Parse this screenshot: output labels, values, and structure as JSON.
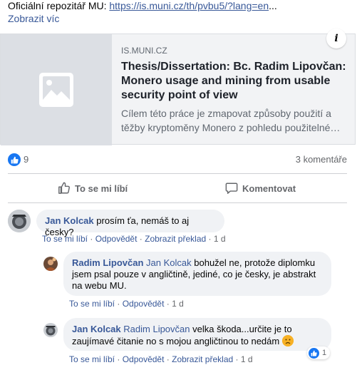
{
  "post": {
    "text_prefix": "Oficiální repozitář MU: ",
    "link_text": "https://is.muni.cz/th/pvbu5/?lang=en",
    "ellipsis": "...",
    "see_more": "Zobrazit víc"
  },
  "preview": {
    "domain": "IS.MUNI.CZ",
    "title": "Thesis/Dissertation: Bc. Radim Lipovčan: Monero usage and mining from usable security point of view",
    "description": "Cílem této práce je zmapovat způsoby použití a těžby kryptoměny Monero z pohledu použitelné…",
    "info_glyph": "i"
  },
  "stats": {
    "likes": "9",
    "comments": "3 komentáře"
  },
  "actions": {
    "like": "To se mi líbí",
    "comment": "Komentovat"
  },
  "comments": [
    {
      "author": "Jan Kolcak",
      "mention": "",
      "text": "prosím ťa, nemáš to aj česky?",
      "like": "To se mi líbí",
      "reply": "Odpovědět",
      "translate": "Zobrazit překlad",
      "time": "1 d"
    },
    {
      "author": "Radim Lipovčan",
      "mention": "Jan Kolcak",
      "text": "bohužel ne, protože diplomku jsem psal pouze v angličtině, jediné, co je česky, je abstrakt na webu MU.",
      "like": "To se mi líbí",
      "reply": "Odpovědět",
      "time": "1 d"
    },
    {
      "author": "Jan Kolcak",
      "mention": "Radim Lipovčan",
      "text": "velka škoda...určite je to zaujímavé čitanie no s mojou angličtinou to nedám",
      "like": "To se mi líbí",
      "reply": "Odpovědět",
      "translate": "Zobrazit překlad",
      "time": "1 d",
      "reaction_count": "1"
    }
  ],
  "meta_separator": "·",
  "colors": {
    "link": "#385898",
    "accent": "#1877f2",
    "muted": "#65676b",
    "bubble": "#f0f2f5"
  }
}
